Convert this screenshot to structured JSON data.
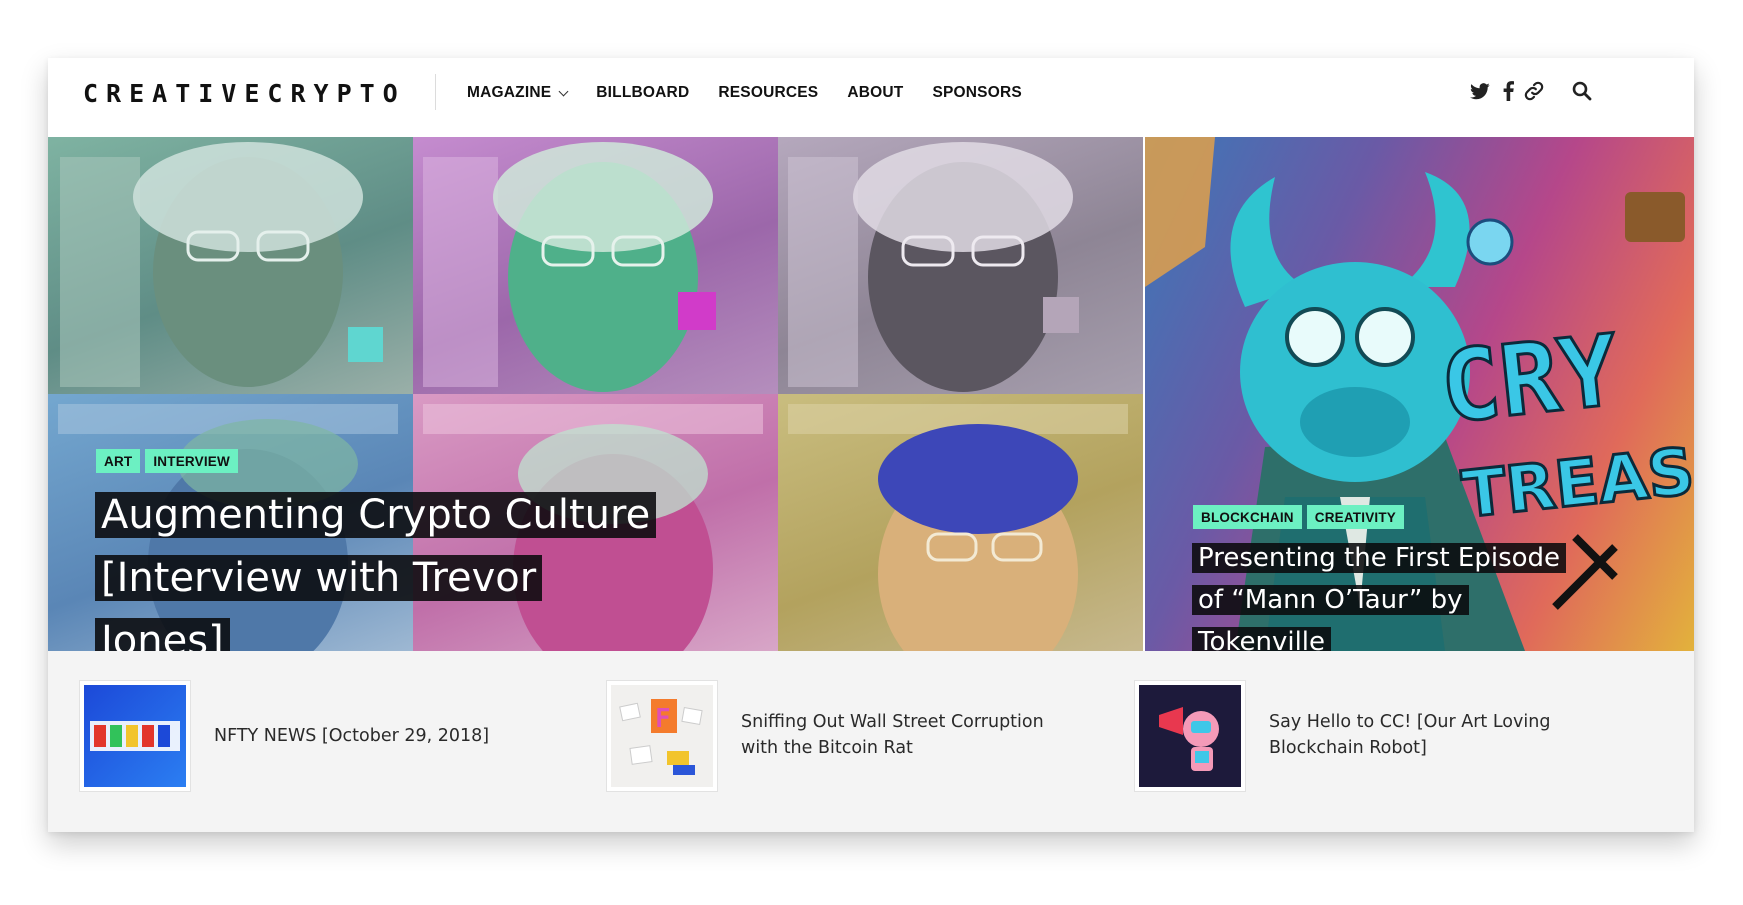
{
  "site": {
    "logo_text": "CREATIVECRYPTO"
  },
  "nav": {
    "items": [
      {
        "label": "MAGAZINE",
        "has_dropdown": true
      },
      {
        "label": "BILLBOARD"
      },
      {
        "label": "RESOURCES"
      },
      {
        "label": "ABOUT"
      },
      {
        "label": "SPONSORS"
      }
    ]
  },
  "header_icons": [
    "twitter-icon",
    "facebook-icon",
    "link-icon",
    "search-icon"
  ],
  "hero": {
    "left": {
      "tags": [
        "ART",
        "INTERVIEW"
      ],
      "title": "Augmenting Crypto Culture [Interview with Trevor Jones]"
    },
    "right": {
      "tags": [
        "BLOCKCHAIN",
        "CREATIVITY"
      ],
      "title": "Presenting the First Episode of “Mann O’Taur” by Tokenville"
    }
  },
  "recent_posts": [
    {
      "title": "NFTY NEWS [October 29, 2018]"
    },
    {
      "title": "Sniffing Out Wall Street Corruption with the Bitcoin Rat"
    },
    {
      "title": "Say Hello to CC! [Our Art Loving Blockchain Robot]"
    }
  ],
  "colors": {
    "tag_bg": "#6cf0c2",
    "title_bg": "#0a0a0c",
    "strip_bg": "#f4f4f4"
  }
}
